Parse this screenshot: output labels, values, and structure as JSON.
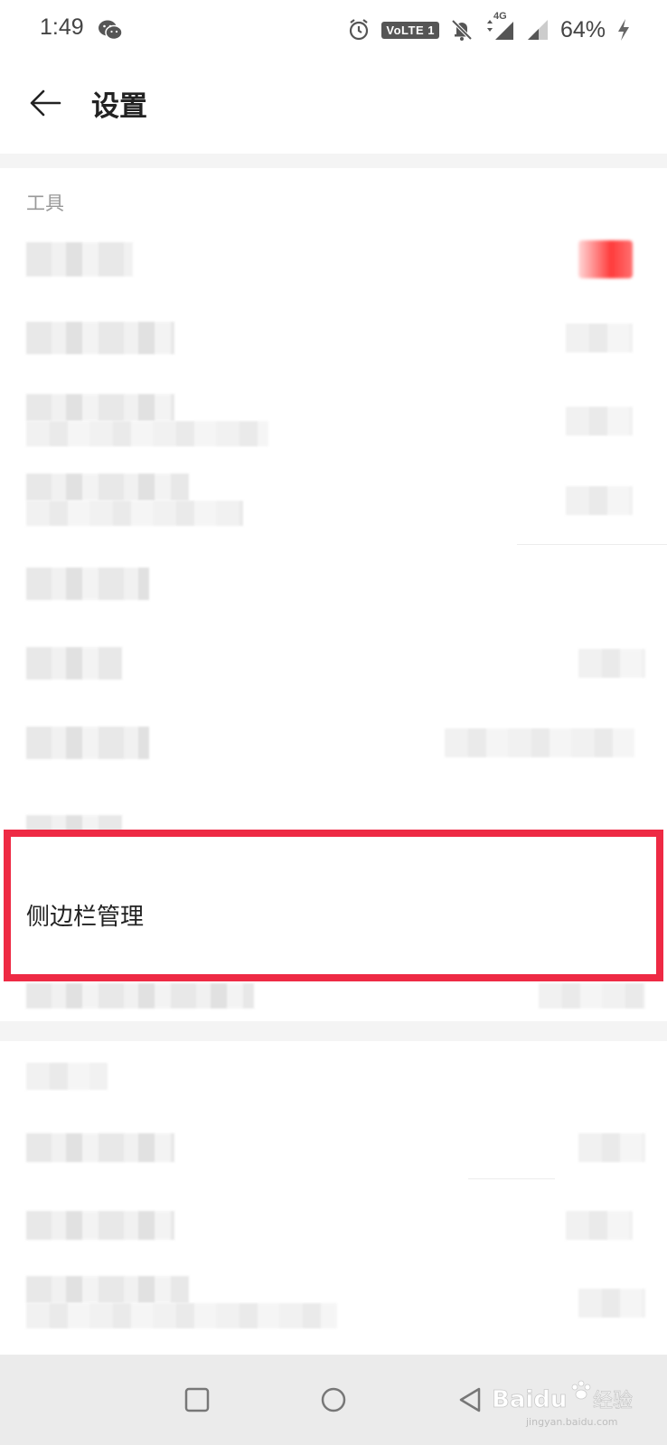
{
  "status_bar": {
    "time": "1:49",
    "volte_label": "VoLTE 1",
    "network_label": "4G",
    "battery_percent": "64%"
  },
  "header": {
    "title": "设置"
  },
  "sections": [
    {
      "title": "工具"
    }
  ],
  "highlighted_item": {
    "label": "侧边栏管理"
  },
  "watermark": {
    "brand": "Baidu",
    "suffix": "经验",
    "url": "jingyan.baidu.com"
  },
  "colors": {
    "highlight_border": "#ee2a44",
    "toggle_accent": "#ff3b3b",
    "nav_bar_bg": "#ebebeb"
  }
}
